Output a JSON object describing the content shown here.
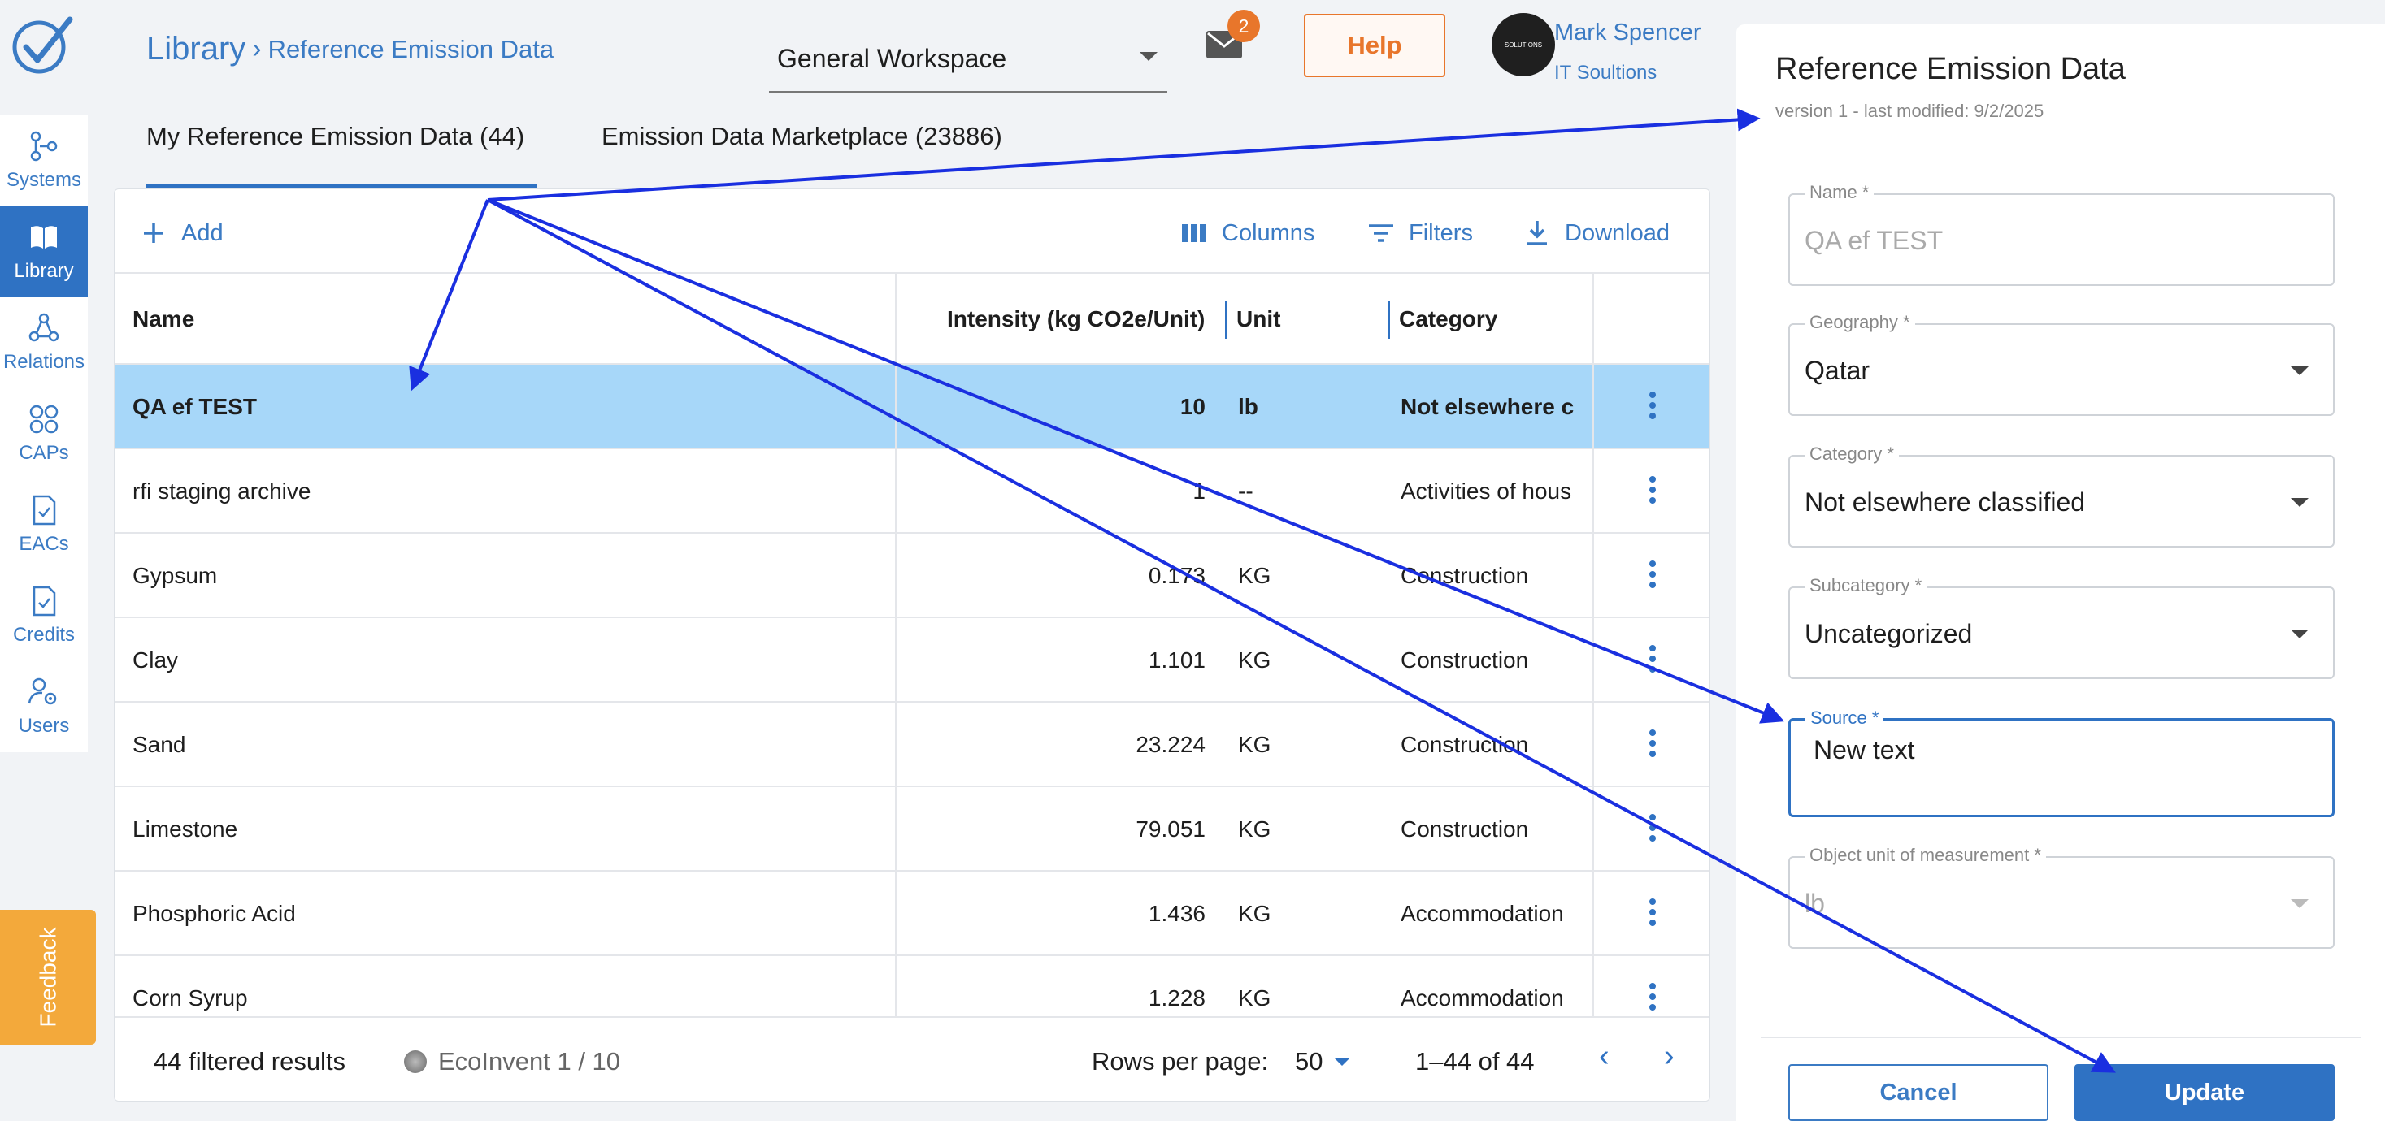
{
  "nav": {
    "items": [
      {
        "label": "Systems",
        "icon": "systems-icon"
      },
      {
        "label": "Library",
        "icon": "book-icon"
      },
      {
        "label": "Relations",
        "icon": "relations-icon"
      },
      {
        "label": "CAPs",
        "icon": "grid-icon"
      },
      {
        "label": "EACs",
        "icon": "document-check-icon"
      },
      {
        "label": "Credits",
        "icon": "document-check-icon"
      },
      {
        "label": "Users",
        "icon": "users-gear-icon"
      }
    ],
    "active": "Library",
    "feedback": "Feedback"
  },
  "header": {
    "breadcrumb_root": "Library",
    "breadcrumb_current": "Reference Emission Data",
    "workspace": "General Workspace",
    "mail_count": "2",
    "help": "Help",
    "user_name": "Mark Spencer",
    "user_org": "IT Soultions",
    "avatar_text": "SOLUTIONS"
  },
  "tabs": [
    {
      "label": "My Reference Emission Data (44)",
      "active": true
    },
    {
      "label": "Emission Data Marketplace (23886)",
      "active": false
    }
  ],
  "toolbar": {
    "add": "Add",
    "columns": "Columns",
    "filters": "Filters",
    "download": "Download"
  },
  "table": {
    "columns": [
      "Name",
      "Intensity (kg CO2e/Unit)",
      "Unit",
      "Category"
    ],
    "rows": [
      {
        "name": "QA ef TEST",
        "intensity": "10",
        "unit": "lb",
        "category": "Not elsewhere c"
      },
      {
        "name": "rfi staging archive",
        "intensity": "1",
        "unit": "--",
        "category": "Activities of hous"
      },
      {
        "name": "Gypsum",
        "intensity": "0.173",
        "unit": "KG",
        "category": "Construction"
      },
      {
        "name": "Clay",
        "intensity": "1.101",
        "unit": "KG",
        "category": "Construction"
      },
      {
        "name": "Sand",
        "intensity": "23.224",
        "unit": "KG",
        "category": "Construction"
      },
      {
        "name": "Limestone",
        "intensity": "79.051",
        "unit": "KG",
        "category": "Construction"
      },
      {
        "name": "Phosphoric Acid",
        "intensity": "1.436",
        "unit": "KG",
        "category": "Accommodation"
      },
      {
        "name": "Corn Syrup",
        "intensity": "1.228",
        "unit": "KG",
        "category": "Accommodation"
      }
    ]
  },
  "footer": {
    "results": "44 filtered results",
    "source": "EcoInvent 1 / 10",
    "rows_per_page_label": "Rows per page:",
    "rows_per_page": "50",
    "range": "1–44 of 44"
  },
  "panel": {
    "title": "Reference Emission Data",
    "subtitle": "version 1 - last modified: 9/2/2025",
    "fields": {
      "name": {
        "label": "Name *",
        "value": "QA ef TEST"
      },
      "geography": {
        "label": "Geography *",
        "value": "Qatar"
      },
      "category": {
        "label": "Category *",
        "value": "Not elsewhere classified"
      },
      "subcategory": {
        "label": "Subcategory *",
        "value": "Uncategorized"
      },
      "source": {
        "label": "Source *",
        "value": "New text"
      },
      "unit": {
        "label": "Object unit of measurement *",
        "value": "lb"
      }
    },
    "cancel": "Cancel",
    "update": "Update"
  },
  "colors": {
    "accent": "#2f72c3",
    "selected_row": "#a7d7f9",
    "help": "#e8762b",
    "feedback": "#f3a93b",
    "annotation": "#1a2fe0"
  }
}
